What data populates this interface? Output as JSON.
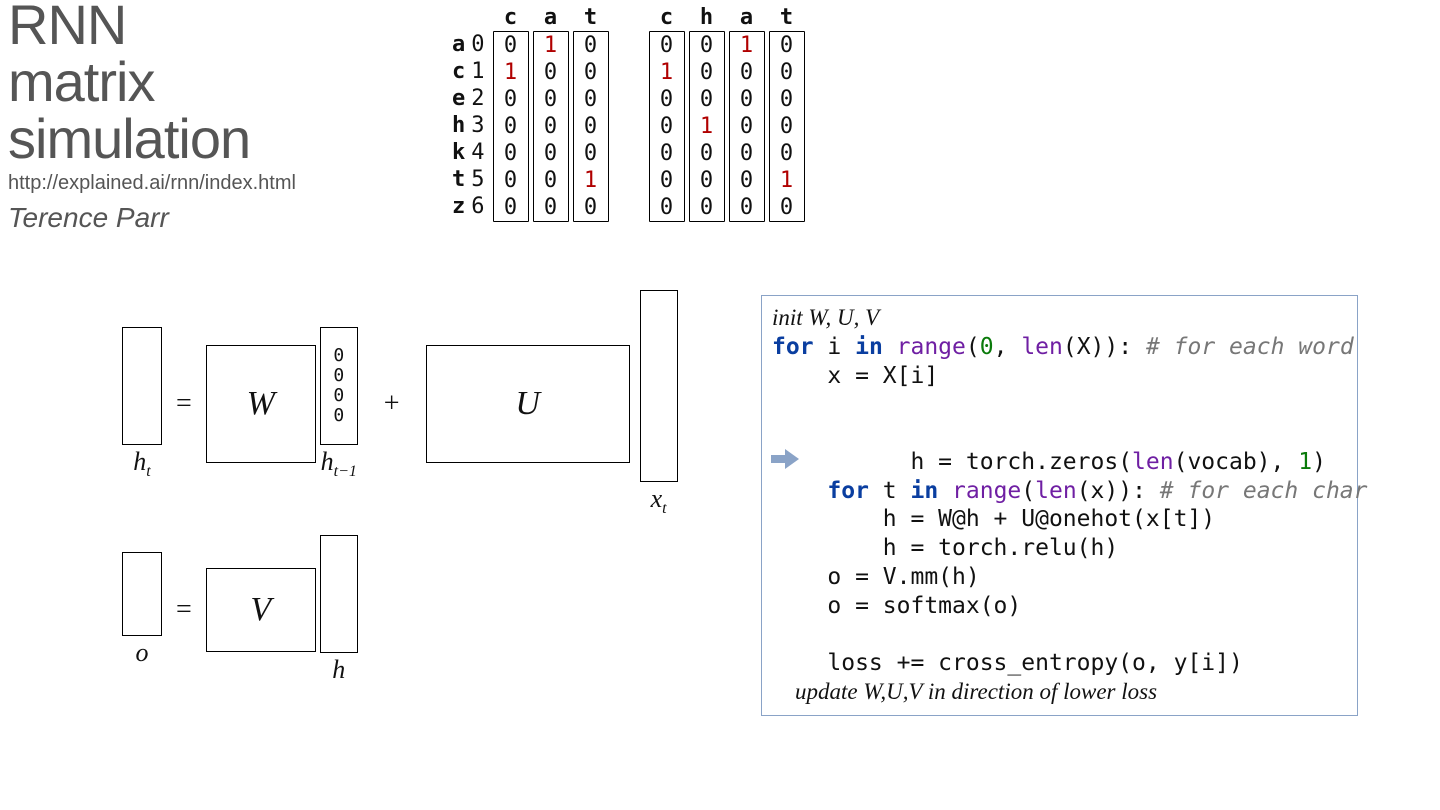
{
  "title": {
    "line1": "RNN",
    "line2": "matrix",
    "line3": "simulation",
    "url": "http://explained.ai/rnn/index.html",
    "author": "Terence Parr"
  },
  "vocab": {
    "chars": [
      "a",
      "c",
      "e",
      "h",
      "k",
      "t",
      "z"
    ],
    "indices": [
      "0",
      "1",
      "2",
      "3",
      "4",
      "5",
      "6"
    ]
  },
  "words": [
    {
      "col_heads": [
        "c",
        "a",
        "t"
      ],
      "columns": [
        [
          "0",
          "1",
          "0",
          "0",
          "0",
          "0",
          "0"
        ],
        [
          "1",
          "0",
          "0",
          "0",
          "0",
          "0",
          "0"
        ],
        [
          "0",
          "0",
          "0",
          "0",
          "0",
          "1",
          "0"
        ]
      ]
    },
    {
      "col_heads": [
        "c",
        "h",
        "a",
        "t"
      ],
      "columns": [
        [
          "0",
          "1",
          "0",
          "0",
          "0",
          "0",
          "0"
        ],
        [
          "0",
          "0",
          "0",
          "1",
          "0",
          "0",
          "0"
        ],
        [
          "1",
          "0",
          "0",
          "0",
          "0",
          "0",
          "0"
        ],
        [
          "0",
          "0",
          "0",
          "0",
          "0",
          "1",
          "0"
        ]
      ]
    }
  ],
  "eq1": {
    "ht": "h",
    "ht_sub": "t",
    "eq": "=",
    "W": "W",
    "hprev_vec": [
      "0",
      "0",
      "0",
      "0"
    ],
    "hprev": "h",
    "hprev_sub": "t−1",
    "plus": "+",
    "U": "U",
    "xt": "x",
    "xt_sub": "t"
  },
  "eq2": {
    "o": "o",
    "eq": "=",
    "V": "V",
    "h": "h"
  },
  "code": {
    "l0": "init W, U, V",
    "l1_for": "for",
    "l1_i": " i ",
    "l1_in": "in",
    "l1_range": " range",
    "l1_args": "(",
    "l1_zero": "0",
    "l1_rest": ", ",
    "l1_len": "len",
    "l1_rest2": "(X)): ",
    "l1_cmt": "# for each word",
    "l2": "    x = X[i]",
    "l3": "",
    "l4": "    h = torch.zeros(",
    "l4_len": "len",
    "l4_mid": "(vocab), ",
    "l4_one": "1",
    "l4_end": ")",
    "l5_for": "    for",
    "l5_t": " t ",
    "l5_in": "in",
    "l5_range": " range",
    "l5_open": "(",
    "l5_len": "len",
    "l5_rest": "(x)): ",
    "l5_cmt": "# for each char",
    "l6": "        h = W@h + U@onehot(x[t])",
    "l7": "        h = torch.relu(h)",
    "l8": "    o = V.mm(h)",
    "l9": "    o = softmax(o)",
    "l10": "",
    "l11": "    loss += cross_entropy(o, y[i])",
    "l12": "    update W,U,V in direction of lower loss"
  }
}
